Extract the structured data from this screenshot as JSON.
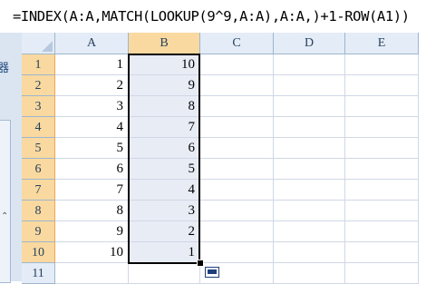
{
  "formula_bar": {
    "formula": "=INDEX(A:A,MATCH(LOOKUP(9^9,A:A),A:A,)+1-ROW(A1))"
  },
  "left_panel": {
    "glyph": "器"
  },
  "sheet": {
    "columns": [
      "A",
      "B",
      "C",
      "D",
      "E"
    ],
    "active_column": "B",
    "rows": [
      {
        "row": "1",
        "A": "1",
        "B": "10"
      },
      {
        "row": "2",
        "A": "2",
        "B": "9"
      },
      {
        "row": "3",
        "A": "3",
        "B": "8"
      },
      {
        "row": "4",
        "A": "4",
        "B": "7"
      },
      {
        "row": "5",
        "A": "5",
        "B": "6"
      },
      {
        "row": "6",
        "A": "6",
        "B": "5"
      },
      {
        "row": "7",
        "A": "7",
        "B": "4"
      },
      {
        "row": "8",
        "A": "8",
        "B": "3"
      },
      {
        "row": "9",
        "A": "9",
        "B": "2"
      },
      {
        "row": "10",
        "A": "10",
        "B": "1"
      },
      {
        "row": "11",
        "A": "",
        "B": ""
      }
    ],
    "selection": "B1:B10"
  }
}
